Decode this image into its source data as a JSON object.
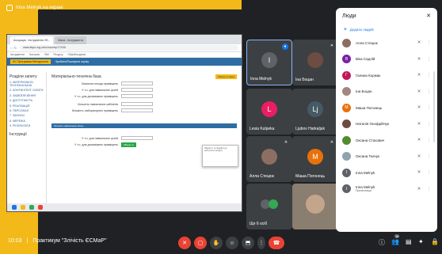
{
  "presenting": {
    "label": "Inna Melnyk на екрані"
  },
  "browser": {
    "tabs": [
      "Асоціація - Інструменти Зб...",
      "Мапа - Інструменти"
    ],
    "url": "www.ekpo.org.ua/rc/survey/1723/6",
    "bookmarks": [
      "Інструменти",
      "Настрою",
      "ЗМІ",
      "Ресурсу",
      "Обробна даних"
    ]
  },
  "site": {
    "header_badge": "ЄС Програмна Методологія",
    "header_text": "Зробити/Поширити оцінку",
    "btn_orange": "Зберегти зміни",
    "sidebar_title": "Розділи запиту",
    "sidebar_items": [
      "1. МАТЕРІАЛЬНО-ТЕХНІЧНА БАЗА",
      "2. КОНТИНГЕНТ ОСВІТИ",
      "3. ЗАБЕЗПЕЧЕННЯ",
      "4. ДОСТУПНІСТЬ",
      "5. РЕАЛІЗАЦІЯ",
      "6. ПЕРСОНАЛ",
      "7. ЗАПИСИ",
      "8. МЕРЕЖА",
      "9. РЕЗУЛЬТАТИ"
    ],
    "sidebar_section2": "Інструкції",
    "main_title": "Матеріально-технічна база",
    "fields": [
      "Загальна площа приміщень",
      "У т.ч. для навчальних цілей",
      "У т.ч. для допоміжних приміщень",
      "Кількість навчальних кабінетів",
      "Кількість лабораторних приміщень"
    ],
    "band_text": "Кількість навчальних місць",
    "popup_text": "Зберегти та перейти до наступного розділу",
    "btn_green": "Зберегти"
  },
  "tiles": [
    {
      "name": "Inna Melnyk",
      "initial": "I",
      "color": "#5f6368",
      "mic_color": "#1a73e8",
      "active": true
    },
    {
      "name": "Іна Боцан",
      "initial": "",
      "color": "#6d4c41",
      "mic_color": "",
      "active": false
    },
    {
      "name": "Lesia Kulpeka",
      "initial": "L",
      "color": "#e91e63",
      "mic_color": "",
      "active": false
    },
    {
      "name": "Ljubov Harkaljuk",
      "initial": "Lj",
      "color": "#455a64",
      "mic_color": "",
      "active": false
    },
    {
      "name": "Алла Стецюк",
      "initial": "",
      "color": "#8d6e63",
      "mic_color": "",
      "active": false
    },
    {
      "name": "Маша Погонець",
      "initial": "M",
      "color": "#e8710a",
      "mic_color": "",
      "active": false
    },
    {
      "name": "Ще 6 осіб",
      "initial": "",
      "color": "#3c4043",
      "mic_color": "",
      "active": false
    },
    {
      "name": "",
      "initial": "",
      "color": "#8a7e70",
      "mic_color": "",
      "active": false
    }
  ],
  "panel": {
    "title": "Люди",
    "add_label": "Додати людей",
    "people": [
      {
        "name": "Алла Стецюк",
        "sub": "",
        "color": "#8d6e63",
        "initial": ""
      },
      {
        "name": "Віка Садлій",
        "sub": "",
        "color": "#7b1fa2",
        "initial": "В"
      },
      {
        "name": "Галина Коржак",
        "sub": "",
        "color": "#c2185b",
        "initial": "Г"
      },
      {
        "name": "Іна Боцан",
        "sub": "",
        "color": "#a1887f",
        "initial": ""
      },
      {
        "name": "Маша Погонець",
        "sub": "",
        "color": "#e8710a",
        "initial": "М"
      },
      {
        "name": "Наталія Онофрійчук",
        "sub": "",
        "color": "#6d4c41",
        "initial": ""
      },
      {
        "name": "Оксана Стахович",
        "sub": "",
        "color": "#558b2f",
        "initial": ""
      },
      {
        "name": "Оксана Ткачук",
        "sub": "",
        "color": "#90a4ae",
        "initial": ""
      },
      {
        "name": "Inna Melnyk",
        "sub": "",
        "color": "#5f6368",
        "initial": "I"
      },
      {
        "name": "Inna Melnyk",
        "sub": "Презентація",
        "color": "#5f6368",
        "initial": "I"
      }
    ]
  },
  "bottom": {
    "time": "10:03",
    "separator": "|",
    "meeting_name": "Практикум \"Злічість ЄСМаР\"",
    "people_count": "16"
  }
}
